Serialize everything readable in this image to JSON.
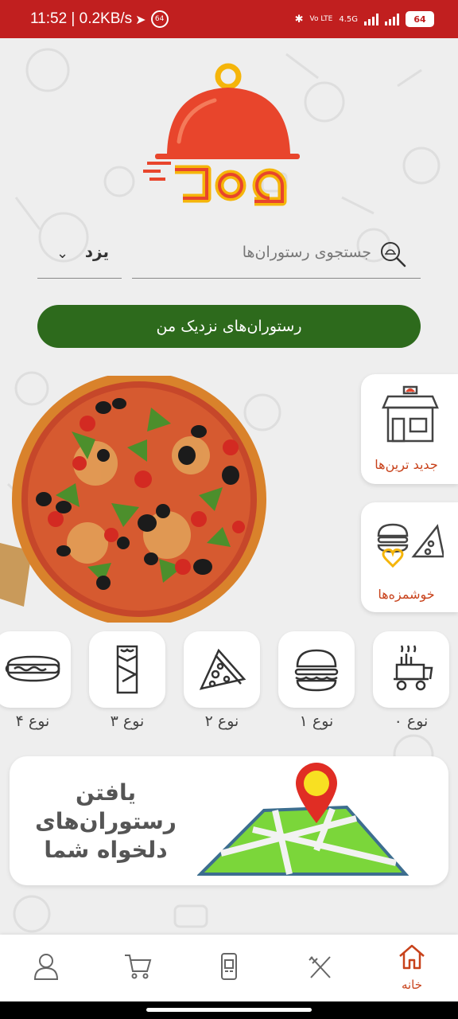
{
  "status_bar": {
    "time": "11:52 | 0.2KB/s",
    "notif_count": "64",
    "network": "4.5G",
    "volte": "Vo LTE",
    "battery": "64"
  },
  "colors": {
    "status_bar_bg": "#c11f1f",
    "primary_button": "#2d6a1c",
    "accent": "#c8421b",
    "logo_red": "#e8452c",
    "logo_yellow": "#f5b50a"
  },
  "search": {
    "city": "یزد",
    "placeholder": "جستجوی رستوران‌ها"
  },
  "nearby_button": "رستوران‌های نزدیک من",
  "side_cards": [
    {
      "label": "جدید ترین‌ها",
      "icon": "shop-icon"
    },
    {
      "label": "خوشمزه‌ها",
      "icon": "food-heart-icon"
    }
  ],
  "categories": [
    {
      "label": "نوع ۰",
      "icon": "fastfood-cart-icon"
    },
    {
      "label": "نوع ۱",
      "icon": "burger-icon"
    },
    {
      "label": "نوع ۲",
      "icon": "pizza-slice-icon"
    },
    {
      "label": "نوع ۳",
      "icon": "wrap-icon"
    },
    {
      "label": "نوع ۴",
      "icon": "hotdog-icon"
    }
  ],
  "find_banner": {
    "line1": "یافتن",
    "line2": "رستوران‌های",
    "line3": "دلخواه شما"
  },
  "bottom_nav": {
    "home_label": "خانه",
    "items": [
      "home-icon",
      "fork-knife-icon",
      "qr-phone-icon",
      "cart-icon",
      "user-icon"
    ]
  }
}
